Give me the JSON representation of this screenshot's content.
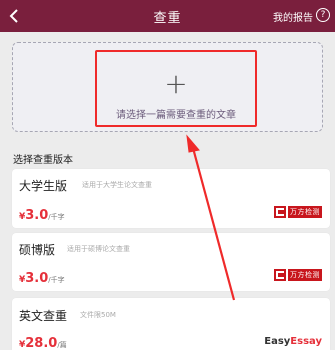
{
  "header": {
    "title": "查重",
    "report_link": "我的报告",
    "help_glyph": "?"
  },
  "upload": {
    "plus": "+",
    "prompt": "请选择一篇需要查重的文章"
  },
  "section_title": "选择查重版本",
  "cards": [
    {
      "name": "大学生版",
      "desc": "适用于大学生论文查重",
      "price_symbol": "¥",
      "price": "3.0",
      "unit": "/千字",
      "brand": "万方检测"
    },
    {
      "name": "硕博版",
      "desc": "适用于硕博论文查重",
      "price_symbol": "¥",
      "price": "3.0",
      "unit": "/千字",
      "brand": "万方检测"
    },
    {
      "name": "英文查重",
      "desc": "文件限50M",
      "price_symbol": "¥",
      "price": "28.0",
      "unit": "/篇",
      "brand_part1": "Easy",
      "brand_part2": "Essay"
    }
  ],
  "colors": {
    "header_bg": "#7a1f3d",
    "price": "#e5303a",
    "highlight": "#ef2a2a"
  }
}
